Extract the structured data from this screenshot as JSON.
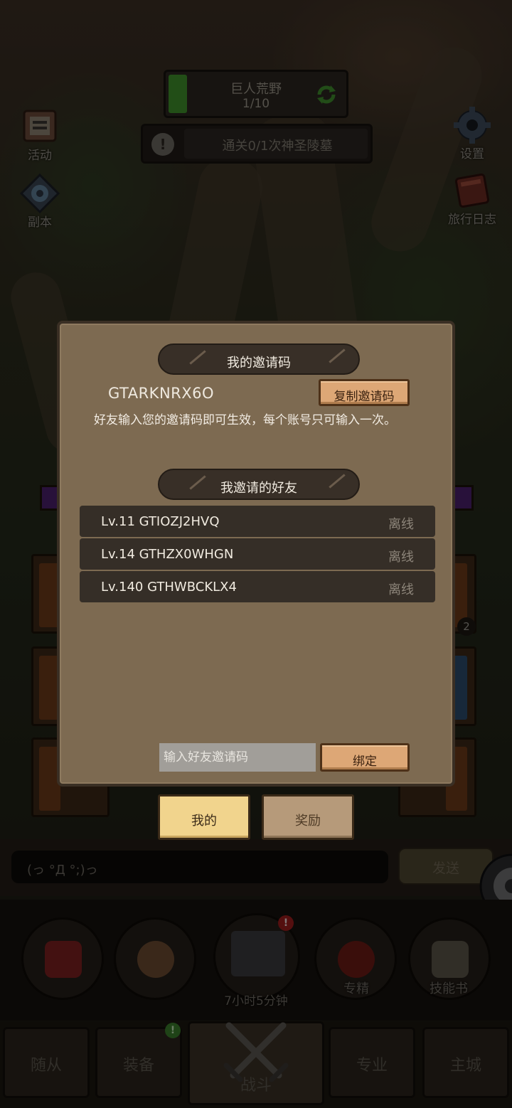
{
  "hud": {
    "stage_name": "巨人荒野",
    "stage_progress": "1/10",
    "quest_text": "通关0/1次神圣陵墓",
    "quest_alert": "!"
  },
  "side_buttons": {
    "activity": "活动",
    "dungeon": "副本",
    "settings": "设置",
    "travel_log": "旅行日志"
  },
  "modal": {
    "my_invite_title": "我的邀请码",
    "invite_code": "GTARKNRX6O",
    "copy_button": "复制邀请码",
    "hint": "好友输入您的邀请码即可生效，每个账号只可输入一次。",
    "invited_friends_title": "我邀请的好友",
    "friends": [
      {
        "name": "Lv.11 GTIOZJ2HVQ",
        "status": "离线"
      },
      {
        "name": "Lv.14 GTHZX0WHGN",
        "status": "离线"
      },
      {
        "name": "Lv.140 GTHWBCKLX4",
        "status": "离线"
      }
    ],
    "input_placeholder": "输入好友邀请码",
    "bind_button": "绑定"
  },
  "tabs": {
    "mine": "我的",
    "rewards": "奖励"
  },
  "chat": {
    "message": "(っ °Д °;)っ",
    "send": "发送"
  },
  "card_badge": "2",
  "skills": {
    "expertise": "专精",
    "skill_book": "技能书",
    "chest_timer": "7小时5分钟",
    "chest_badge": "!"
  },
  "nav": {
    "followers": "随从",
    "equipment": "装备",
    "battle": "战斗",
    "profession": "专业",
    "main_city": "主城",
    "equipment_badge": "!"
  },
  "colors": {
    "modal_bg": "#7d6a51",
    "ribbon_bg": "#382f27",
    "wood_button": "#dda776",
    "active_tab": "#f1d48d",
    "friend_row": "#352e27"
  }
}
